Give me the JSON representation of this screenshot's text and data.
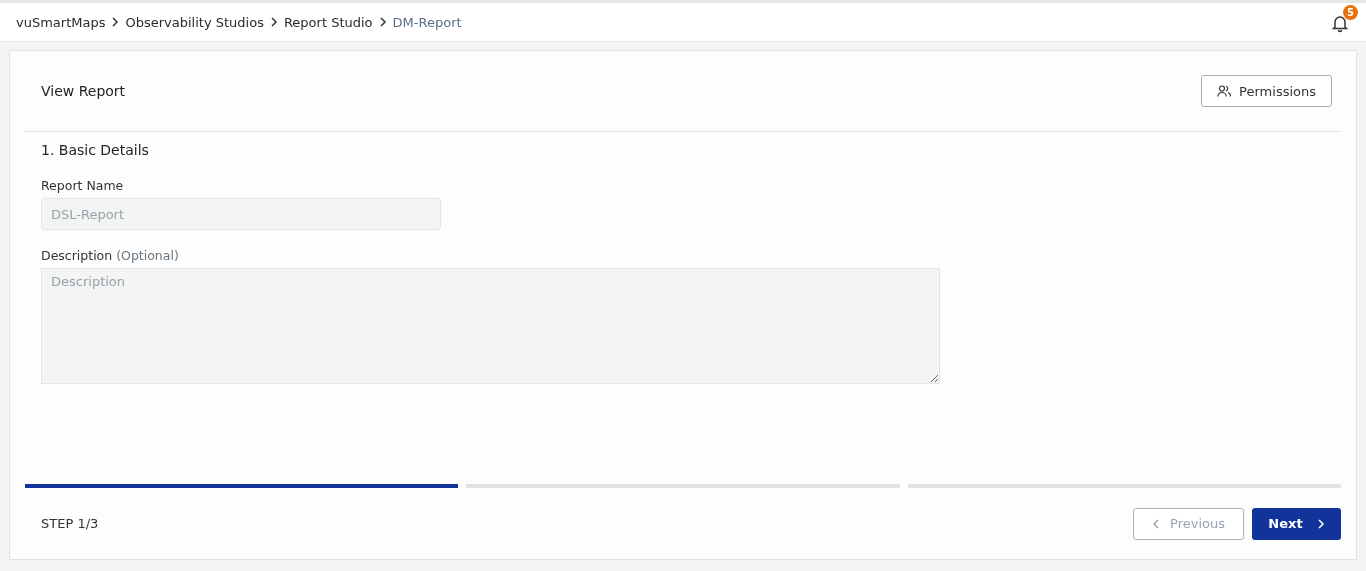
{
  "breadcrumb": [
    {
      "label": "vuSmartMaps",
      "current": false
    },
    {
      "label": "Observability Studios",
      "current": false
    },
    {
      "label": "Report Studio",
      "current": false
    },
    {
      "label": "DM-Report",
      "current": true
    }
  ],
  "notifications": {
    "count": "5"
  },
  "header": {
    "title": "View Report",
    "permissions_button": "Permissions"
  },
  "section": {
    "title": "1. Basic Details"
  },
  "fields": [
    {
      "kind": "input",
      "label": "Report Name",
      "value": "DSL-Report",
      "disabled": true
    },
    {
      "kind": "textarea",
      "label": "Description",
      "hint": "(Optional)",
      "placeholder": "Description",
      "disabled": true
    }
  ],
  "steps": [
    {
      "selected": true
    },
    {
      "selected": false
    },
    {
      "selected": false
    }
  ],
  "footer": {
    "step_label": "STEP 1/3",
    "previous": {
      "label": "Previous",
      "disabled": true
    },
    "next": {
      "label": "Next",
      "disabled": false
    }
  }
}
